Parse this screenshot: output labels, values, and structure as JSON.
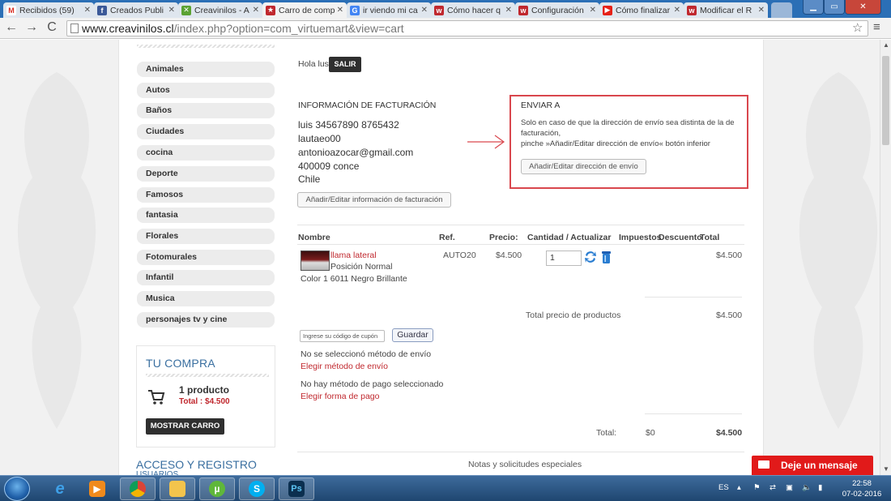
{
  "browser": {
    "tabs": [
      {
        "label": "Recibidos (59)",
        "icon": "gmail-icon",
        "color": "#d93025"
      },
      {
        "label": "Creados Publi",
        "icon": "facebook-icon",
        "color": "#3b5998"
      },
      {
        "label": "Creavinilos - A",
        "icon": "joomla-icon",
        "color": "#5ba233"
      },
      {
        "label": "Carro de comp",
        "icon": "creavinilos-icon",
        "color": "#c0282e",
        "active": true
      },
      {
        "label": "ir viendo mi ca",
        "icon": "google-icon",
        "color": "#4285f4"
      },
      {
        "label": "Cómo hacer q",
        "icon": "w-icon",
        "color": "#c0282e"
      },
      {
        "label": "Configuración",
        "icon": "w-icon",
        "color": "#c0282e"
      },
      {
        "label": "Cómo finalizar",
        "icon": "youtube-icon",
        "color": "#e62117"
      },
      {
        "label": "Modificar el R",
        "icon": "w-icon",
        "color": "#c0282e"
      }
    ],
    "url_domain": "www.creavinilos.cl",
    "url_path": "/index.php?option=com_virtuemart&view=cart"
  },
  "sidebar": {
    "categories": [
      "Animales",
      "Autos",
      "Baños",
      "Ciudades",
      "cocina",
      "Deporte",
      "Famosos",
      "fantasia",
      "Florales",
      "Fotomurales",
      "Infantil",
      "Musica",
      "personajes tv y cine"
    ],
    "compra": {
      "title": "TU COMPRA",
      "count": "1 producto",
      "total": "Total : $4.500",
      "button": "MOSTRAR CARRO"
    },
    "acceso": {
      "title": "ACCESO Y REGISTRO",
      "subtitle": "USUARIOS"
    }
  },
  "user": {
    "greeting": "Hola lus",
    "logout": "SALIR"
  },
  "billing": {
    "title": "INFORMACIÓN DE FACTURACIÓN",
    "lines": [
      "luis 34567890 8765432",
      "lautaeo00",
      "antonioazocar@gmail.com",
      "400009 conce",
      "Chile"
    ],
    "button": "Añadir/Editar información de facturación"
  },
  "shipping": {
    "title": "ENVIAR A",
    "text_1": "Solo en caso de que la dirección de envío sea distinta de la de facturación,",
    "text_2": "pinche »Añadir/Editar dirección de envío« botón inferior",
    "button": "Añadir/Editar dirección de envío"
  },
  "cart_table": {
    "headers": {
      "nombre": "Nombre",
      "ref": "Ref.",
      "precio": "Precio:",
      "cantidad": "Cantidad / Actualizar",
      "impuestos": "Impuestos",
      "descuento": "Descuento",
      "total": "Total"
    },
    "item": {
      "name": "llama lateral",
      "position": "Posición Normal",
      "color": "Color 1 6011 Negro Brillante",
      "ref": "AUTO20",
      "price": "$4.500",
      "quantity": "1",
      "total": "$4.500"
    },
    "products_total_label": "Total precio de productos",
    "products_total_value": "$4.500"
  },
  "coupon": {
    "placeholder": "Ingrese su código de cupón",
    "button": "Guardar"
  },
  "shipping_method": {
    "status": "No se seleccionó método de envío",
    "link": "Elegir método de envío"
  },
  "payment_method": {
    "status": "No hay método de pago seleccionado",
    "link": "Elegir forma de pago"
  },
  "grand_total": {
    "label": "Total:",
    "tax": "$0",
    "value": "$4.500"
  },
  "notes_label": "Notas y solicitudes especiales",
  "chat": {
    "label": "Deje un mensaje"
  },
  "taskbar": {
    "language": "ES",
    "time": "22:58",
    "date": "07-02-2016"
  }
}
